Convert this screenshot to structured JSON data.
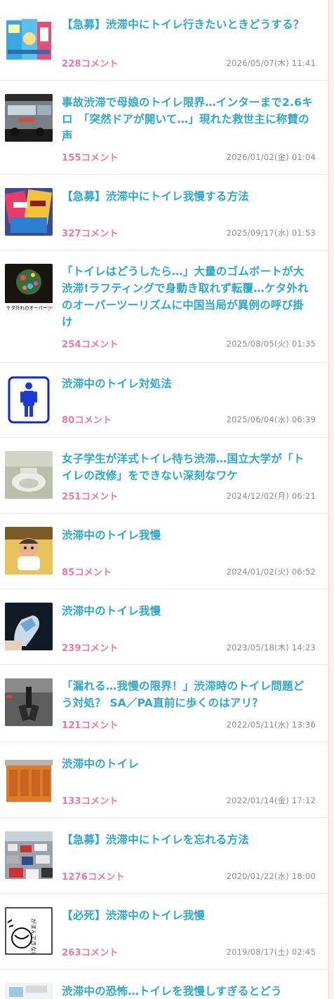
{
  "articles": [
    {
      "title": "【急募】渋滞中にトイレ行きたいときどうする？",
      "comments": "228コメント",
      "date": "2026/05/07(木) 11:41",
      "thumb_icon": "book-cover-thumbnail"
    },
    {
      "title": "事故渋滞で母娘のトイレ限界…インターまで2.6キロ　「突然ドアが開いて…」現れた救世主に称賛の声",
      "comments": "155コメント",
      "date": "2026/01/02(金) 01:04",
      "thumb_icon": "bus-photo-thumbnail"
    },
    {
      "title": "【急募】渋滞中にトイレ我慢する方法",
      "comments": "327コメント",
      "date": "2025/09/17(水) 01:53",
      "thumb_icon": "snack-packages-thumbnail"
    },
    {
      "title": "「トイレはどうしたら…」大量のゴムボートが大渋滞!ラフティングで身動き取れず転覆…ケタ外れのオーバーツーリズムに中国当局が異例の呼び掛け",
      "comments": "254コメント",
      "date": "2025/08/05(火) 01:35",
      "thumb_icon": "rafting-crowd-thumbnail",
      "thumb_caption": "ケタ外れのオーバーツーリ"
    },
    {
      "title": "渋滞中のトイレ対処法",
      "comments": "80コメント",
      "date": "2025/06/04(水) 06:39",
      "thumb_icon": "toilet-sign-icon"
    },
    {
      "title": "女子学生が洋式トイレ待ち渋滞…国立大学が「トイレの改修」をできない深刻なワケ",
      "comments": "251コメント",
      "date": "2024/12/02(月) 06:21",
      "thumb_icon": "squat-toilet-thumbnail"
    },
    {
      "title": "渋滞中のトイレ我慢",
      "comments": "85コメント",
      "date": "2024/01/02(火) 06:52",
      "thumb_icon": "anime-character-thumbnail"
    },
    {
      "title": "渋滞中のトイレ我慢",
      "comments": "239コメント",
      "date": "2023/05/18(木) 14:23",
      "thumb_icon": "portable-bag-thumbnail"
    },
    {
      "title": "「漏れる…我慢の限界！」渋滞時のトイレ問題どう対処？ SA／PA直前に歩くのはアリ？",
      "comments": "121コメント",
      "date": "2022/05/11(水) 13:36",
      "thumb_icon": "road-walker-thumbnail"
    },
    {
      "title": "渋滞中のトイレ",
      "comments": "133コメント",
      "date": "2022/01/14(金) 17:12",
      "thumb_icon": "portable-toilets-thumbnail"
    },
    {
      "title": "【急募】渋滞中にトイレを忘れる方法",
      "comments": "1276コメント",
      "date": "2020/01/22(水) 18:00",
      "thumb_icon": "traffic-jam-thumbnail"
    },
    {
      "title": "【必死】渋滞中のトイレ我慢",
      "comments": "263コメント",
      "date": "2019/08/17(土) 02:45",
      "thumb_icon": "manga-panel-thumbnail",
      "thumb_caption": "がまんできない"
    },
    {
      "title": "渋滞中の恐怖…トイレを我慢しすぎるとどう",
      "comments": "",
      "date": "",
      "thumb_icon": "illustration-thumbnail"
    }
  ]
}
